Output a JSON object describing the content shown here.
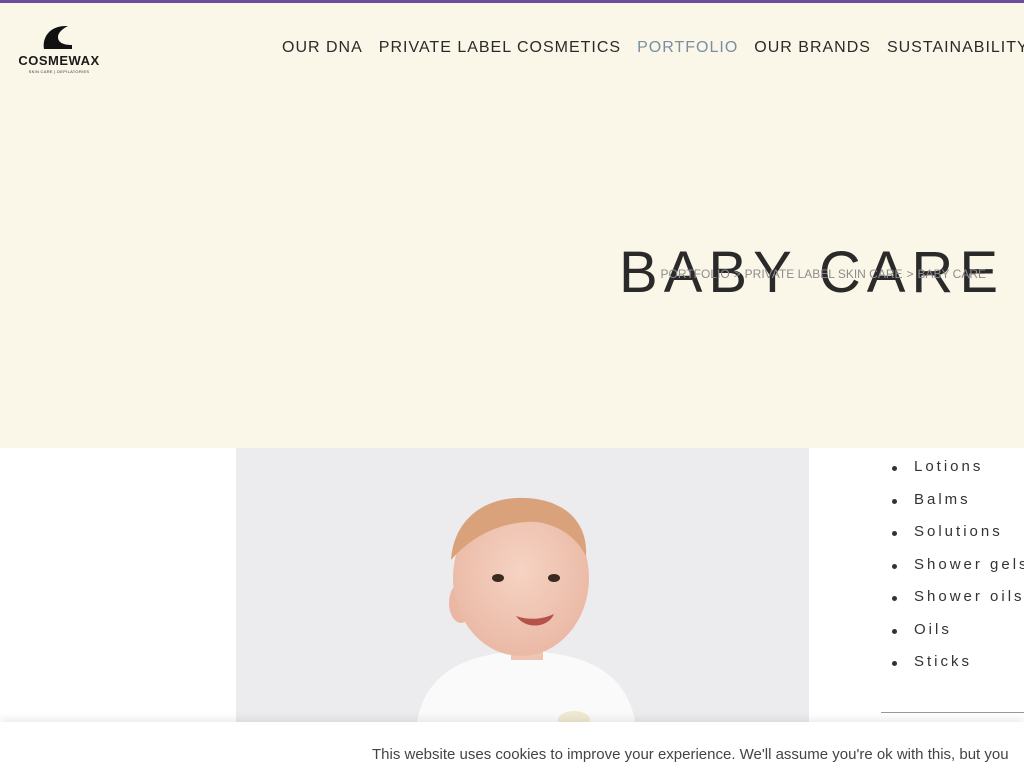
{
  "brand": {
    "name": "COSMEWAX",
    "tagline": "SKIN CARE | DEPILATORIES"
  },
  "nav": {
    "items": [
      {
        "label": "OUR DNA"
      },
      {
        "label": "PRIVATE LABEL COSMETICS"
      },
      {
        "label": "PORTFOLIO"
      },
      {
        "label": "OUR BRANDS"
      },
      {
        "label": "SUSTAINABILITY"
      }
    ],
    "active_item": "PORTFOLIO"
  },
  "hero": {
    "title": "BABY CARE",
    "breadcrumb": [
      "PORTFOLIO",
      "PRIVATE LABEL SKIN CARE",
      "BABY CARE"
    ],
    "breadcrumb_separator": ">"
  },
  "products": [
    "Lotions",
    "Balms",
    "Solutions",
    "Shower gels",
    "Shower oils",
    "Oils",
    "Sticks"
  ],
  "cookie": {
    "text": "This website uses cookies to improve your experience. We'll assume you're ok with this, but you"
  },
  "colors": {
    "top_stripe": "#6b4e9b",
    "header_bg": "#fbf7e8",
    "nav_active": "#7a8ea3",
    "text": "#2a2a2a"
  }
}
